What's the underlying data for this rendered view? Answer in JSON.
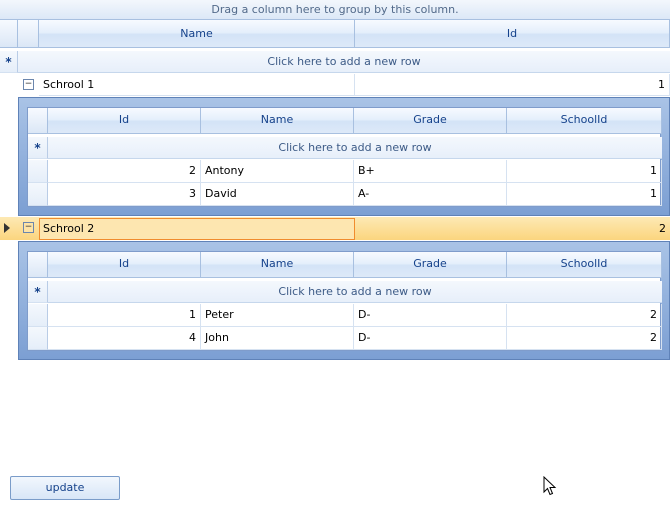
{
  "group_panel": "Drag a column here to group by this column.",
  "master": {
    "columns": [
      "Name",
      "Id"
    ],
    "new_row": "Click here to add a new row",
    "rows": [
      {
        "name": "Schrool 1",
        "id": "1",
        "detail": {
          "columns": [
            "Id",
            "Name",
            "Grade",
            "SchoolId"
          ],
          "new_row": "Click here to add a new row",
          "rows": [
            {
              "id": "2",
              "name": "Antony",
              "grade": "B+",
              "school_id": "1"
            },
            {
              "id": "3",
              "name": "David",
              "grade": "A-",
              "school_id": "1"
            }
          ]
        }
      },
      {
        "name": "Schrool 2",
        "id": "2",
        "detail": {
          "columns": [
            "Id",
            "Name",
            "Grade",
            "SchoolId"
          ],
          "new_row": "Click here to add a new row",
          "rows": [
            {
              "id": "1",
              "name": "Peter",
              "grade": "D-",
              "school_id": "2"
            },
            {
              "id": "4",
              "name": "John",
              "grade": "D-",
              "school_id": "2"
            }
          ]
        }
      }
    ]
  },
  "update_button": "update",
  "icons": {
    "new_row": "asterisk-icon",
    "current_row": "arrow-right-icon",
    "expander": "collapse-minus-icon",
    "cursor": "mouse-pointer-icon"
  },
  "colors": {
    "header_text": "#15428b",
    "selected_row": "#fbd57e",
    "selected_border": "#f08c2e",
    "detail_frame": "#7c9fd3"
  }
}
